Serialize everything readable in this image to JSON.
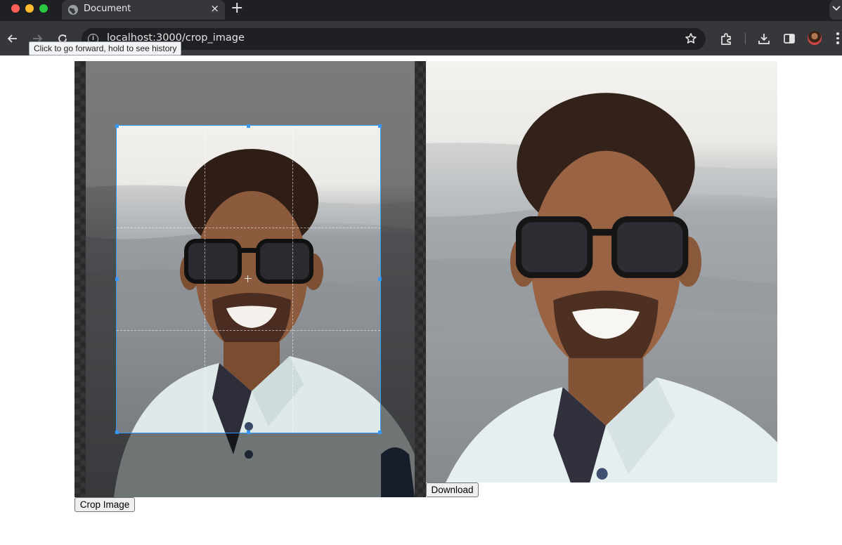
{
  "browser": {
    "tab_title": "Document",
    "tab_close": "×",
    "new_tab": "+",
    "url": "localhost:3000/crop_image",
    "tooltip": "Click to go forward, hold to see history",
    "icons": [
      "back-icon",
      "forward-icon",
      "reload-icon",
      "site-info-icon",
      "bookmark-star-icon",
      "extensions-icon",
      "downloads-icon",
      "side-panel-icon",
      "profile-avatar",
      "more-menu-icon"
    ]
  },
  "page": {
    "crop_button": "Crop Image",
    "download_button": "Download"
  },
  "colors": {
    "chrome_dark": "#1f2023",
    "chrome_toolbar": "#36373a",
    "crop_outline": "#3399ff"
  }
}
